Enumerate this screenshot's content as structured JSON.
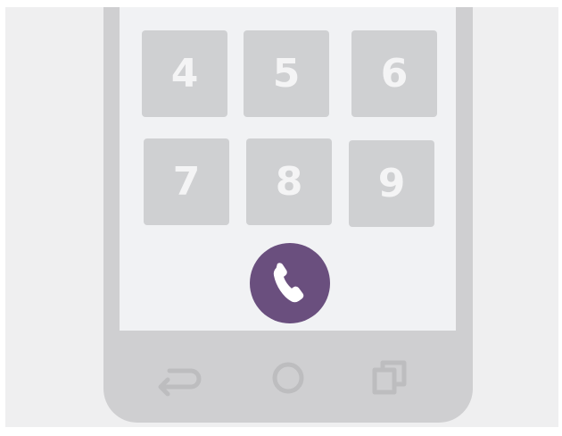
{
  "keypad": {
    "keys": [
      "4",
      "5",
      "6",
      "7",
      "8",
      "9"
    ]
  },
  "call_button": {
    "icon": "phone-icon",
    "color": "#6a4f7e"
  },
  "navbar": {
    "icons": [
      "back-icon",
      "home-icon",
      "recents-icon"
    ],
    "icon_color": "#bdbdbf"
  },
  "colors": {
    "background": "#efeff0",
    "phone_body": "#cfcfd1",
    "screen": "#f1f2f4",
    "key": "#cfd0d2",
    "key_text": "#f4f4f5"
  }
}
